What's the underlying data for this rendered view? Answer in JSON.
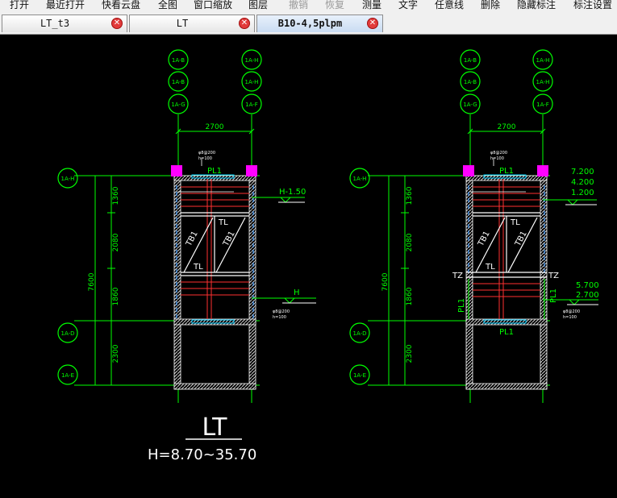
{
  "menu": [
    "打开",
    "最近打开",
    "快看云盘",
    "全图",
    "窗口缩放",
    "图层",
    "撤销",
    "恢复",
    "测量",
    "文字",
    "任意线",
    "删除",
    "隐藏标注",
    "标注设置"
  ],
  "tabs": [
    {
      "label": "LT_t3"
    },
    {
      "label": "LT"
    },
    {
      "label": "B10-4,5plpm",
      "active": true
    }
  ],
  "drawing": {
    "grid_bubbles_top": [
      "1A-B",
      "1A-B",
      "1A-G",
      "1A-H",
      "1A-H",
      "1A-F"
    ],
    "grid_bubbles_left": [
      "1A-H",
      "1A-D",
      "1A-E"
    ],
    "dim_width": "2700",
    "dim_total": "7600",
    "dim_segments": [
      "1360",
      "2080",
      "1860",
      "2300"
    ],
    "beam_pl1": "PL1",
    "beam_tl": "TL",
    "flight_tb1": "TB1",
    "column_tz": "TZ",
    "beam_note_1": "φ8@200",
    "beam_note_2": "h=100",
    "left_level_top": "H-1.50",
    "left_level_mid": "H",
    "right_levels_top": [
      "7.200",
      "4.200",
      "1.200"
    ],
    "right_levels_mid": [
      "5.700",
      "2.700"
    ],
    "title": "LT",
    "subtitle": "H=8.70~35.70"
  },
  "colors": {
    "background": "#000000",
    "linework": "#ffffff",
    "annotation": "#00ff00",
    "stair_red": "#ff3030",
    "column_magenta": "#ff00ff",
    "dashed_blue": "#4aa0ff"
  }
}
